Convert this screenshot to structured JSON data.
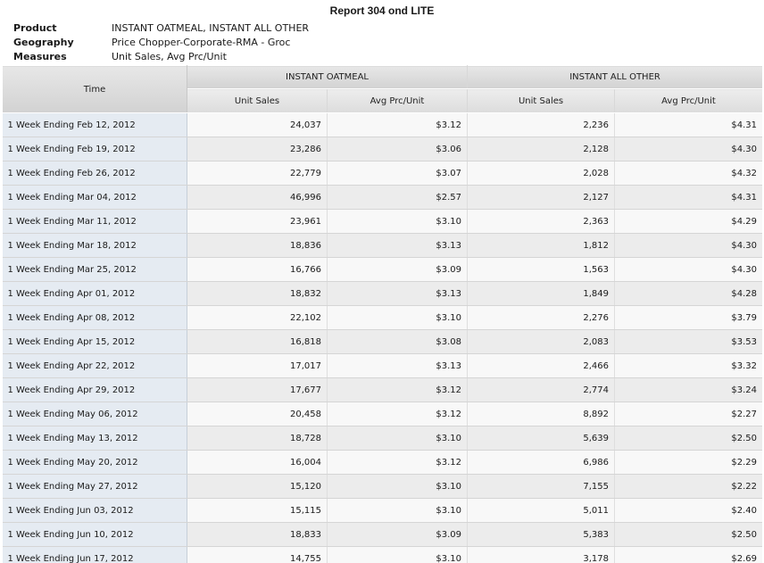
{
  "report": {
    "title": "Report 304 ond LITE",
    "meta": [
      {
        "label": "Product",
        "value": "INSTANT OATMEAL, INSTANT ALL OTHER"
      },
      {
        "label": "Geography",
        "value": "Price Chopper-Corporate-RMA - Groc"
      },
      {
        "label": "Measures",
        "value": "Unit Sales, Avg Prc/Unit"
      }
    ]
  },
  "table": {
    "time_header": "Time",
    "groups": [
      "INSTANT OATMEAL",
      "INSTANT ALL OTHER"
    ],
    "measures": [
      "Unit Sales",
      "Avg Prc/Unit",
      "Unit Sales",
      "Avg Prc/Unit"
    ],
    "rows": [
      {
        "time": "1 Week Ending Feb 12, 2012",
        "v": [
          "24,037",
          "$3.12",
          "2,236",
          "$4.31"
        ]
      },
      {
        "time": "1 Week Ending Feb 19, 2012",
        "v": [
          "23,286",
          "$3.06",
          "2,128",
          "$4.30"
        ]
      },
      {
        "time": "1 Week Ending Feb 26, 2012",
        "v": [
          "22,779",
          "$3.07",
          "2,028",
          "$4.32"
        ]
      },
      {
        "time": "1 Week Ending Mar 04, 2012",
        "v": [
          "46,996",
          "$2.57",
          "2,127",
          "$4.31"
        ]
      },
      {
        "time": "1 Week Ending Mar 11, 2012",
        "v": [
          "23,961",
          "$3.10",
          "2,363",
          "$4.29"
        ]
      },
      {
        "time": "1 Week Ending Mar 18, 2012",
        "v": [
          "18,836",
          "$3.13",
          "1,812",
          "$4.30"
        ]
      },
      {
        "time": "1 Week Ending Mar 25, 2012",
        "v": [
          "16,766",
          "$3.09",
          "1,563",
          "$4.30"
        ]
      },
      {
        "time": "1 Week Ending Apr 01, 2012",
        "v": [
          "18,832",
          "$3.13",
          "1,849",
          "$4.28"
        ]
      },
      {
        "time": "1 Week Ending Apr 08, 2012",
        "v": [
          "22,102",
          "$3.10",
          "2,276",
          "$3.79"
        ]
      },
      {
        "time": "1 Week Ending Apr 15, 2012",
        "v": [
          "16,818",
          "$3.08",
          "2,083",
          "$3.53"
        ]
      },
      {
        "time": "1 Week Ending Apr 22, 2012",
        "v": [
          "17,017",
          "$3.13",
          "2,466",
          "$3.32"
        ]
      },
      {
        "time": "1 Week Ending Apr 29, 2012",
        "v": [
          "17,677",
          "$3.12",
          "2,774",
          "$3.24"
        ]
      },
      {
        "time": "1 Week Ending May 06, 2012",
        "v": [
          "20,458",
          "$3.12",
          "8,892",
          "$2.27"
        ]
      },
      {
        "time": "1 Week Ending May 13, 2012",
        "v": [
          "18,728",
          "$3.10",
          "5,639",
          "$2.50"
        ]
      },
      {
        "time": "1 Week Ending May 20, 2012",
        "v": [
          "16,004",
          "$3.12",
          "6,986",
          "$2.29"
        ]
      },
      {
        "time": "1 Week Ending May 27, 2012",
        "v": [
          "15,120",
          "$3.10",
          "7,155",
          "$2.22"
        ]
      },
      {
        "time": "1 Week Ending Jun 03, 2012",
        "v": [
          "15,115",
          "$3.10",
          "5,011",
          "$2.40"
        ]
      },
      {
        "time": "1 Week Ending Jun 10, 2012",
        "v": [
          "18,833",
          "$3.09",
          "5,383",
          "$2.50"
        ]
      },
      {
        "time": "1 Week Ending Jun 17, 2012",
        "v": [
          "14,755",
          "$3.10",
          "3,178",
          "$2.69"
        ]
      }
    ]
  }
}
